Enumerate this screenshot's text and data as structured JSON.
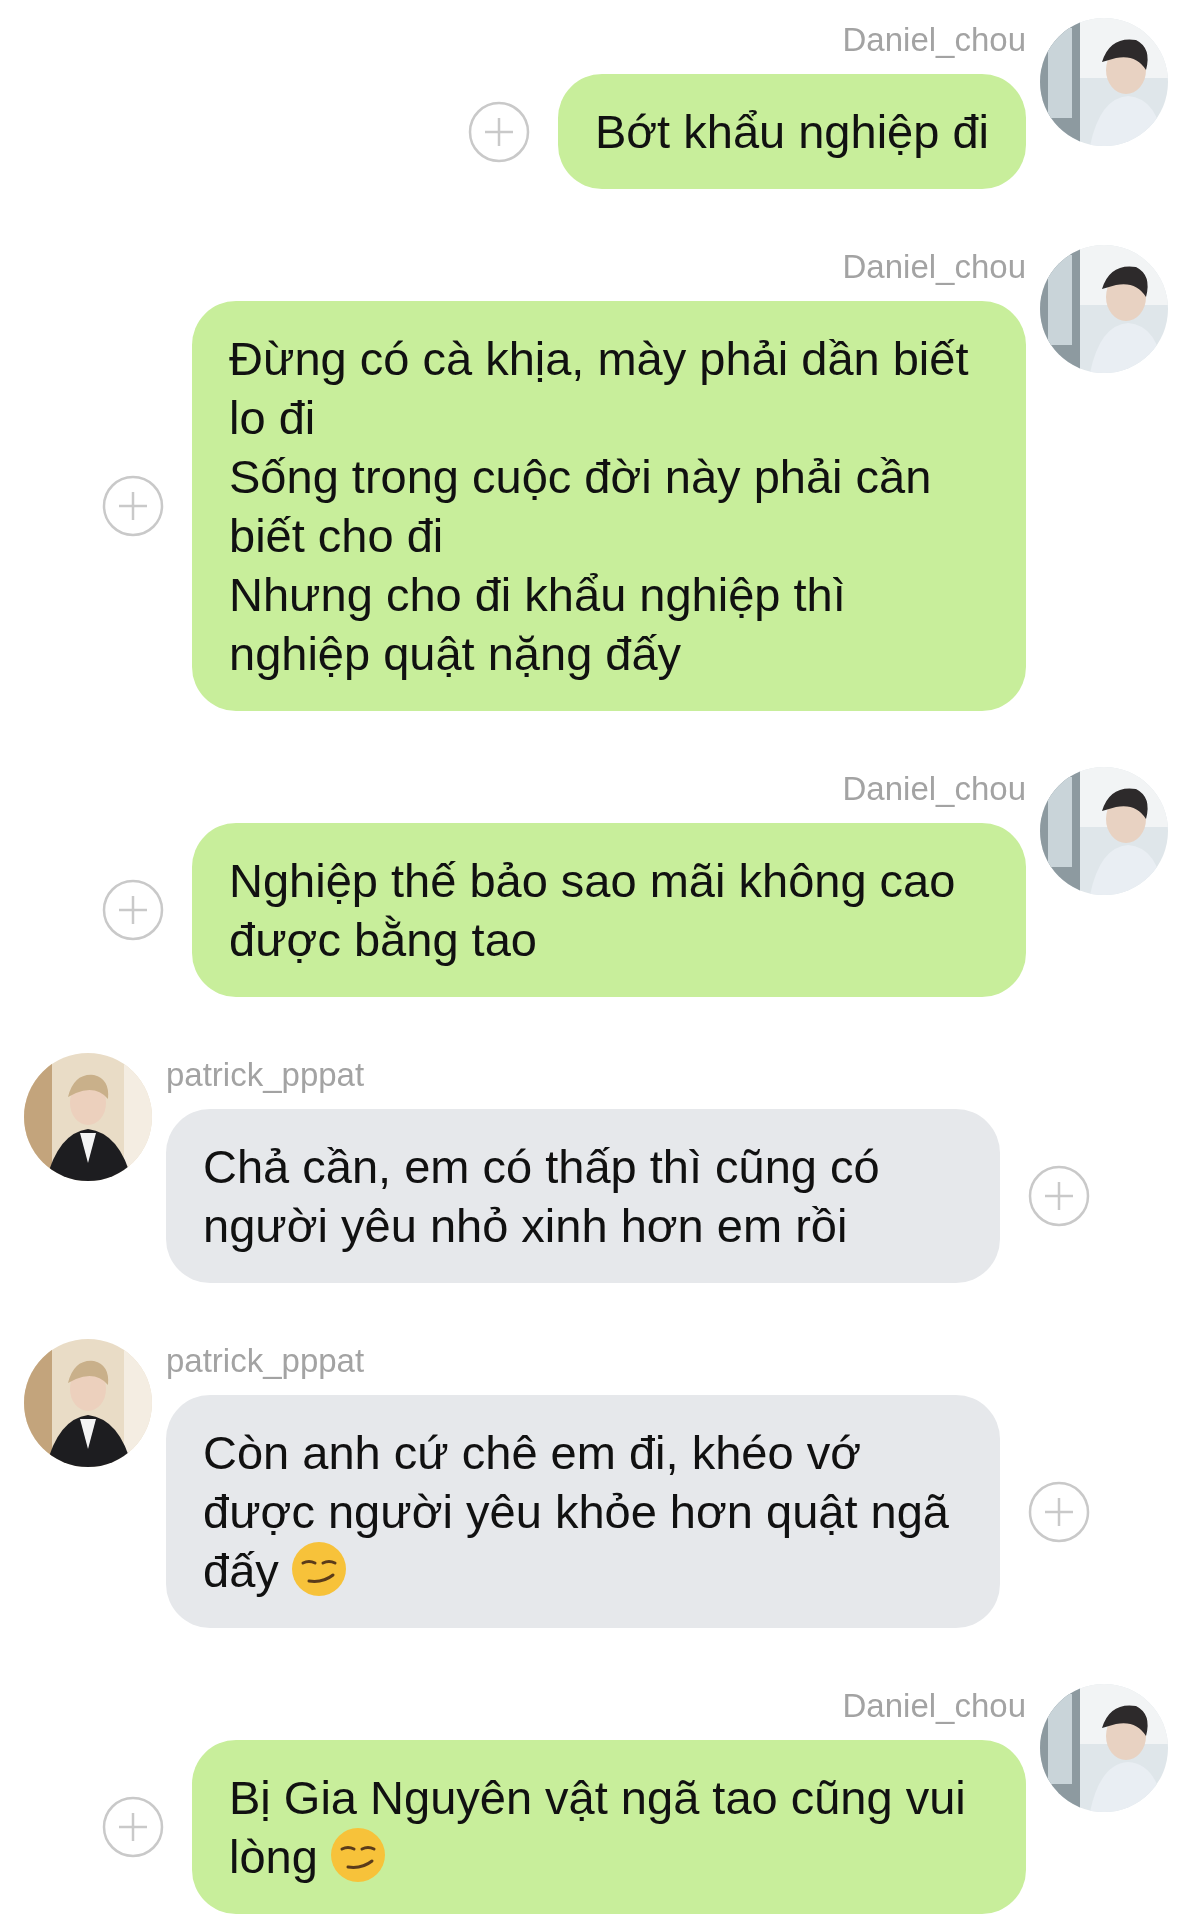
{
  "messages": [
    {
      "kind": "outgoing",
      "sender": "Daniel_chou",
      "paragraphs": [
        "Bớt khẩu nghiệp đi"
      ]
    },
    {
      "kind": "outgoing",
      "sender": "Daniel_chou",
      "paragraphs": [
        "Đừng có cà khịa, mày phải dần biết lo đi",
        "Sống trong cuộc đời này phải cần biết cho đi",
        "Nhưng cho đi khẩu nghiệp thì nghiệp quật nặng đấy"
      ]
    },
    {
      "kind": "outgoing",
      "sender": "Daniel_chou",
      "paragraphs": [
        "Nghiệp thế bảo sao mãi không cao được bằng tao"
      ]
    },
    {
      "kind": "incoming",
      "sender": "patrick_pppat",
      "paragraphs": [
        "Chả cần, em có thấp thì cũng có người yêu nhỏ xinh hơn em rồi"
      ]
    },
    {
      "kind": "incoming",
      "sender": "patrick_pppat",
      "paragraphs": [
        "Còn anh cứ chê em đi, khéo vớ được người yêu khỏe hơn quật ngã đấy"
      ],
      "emoji": {
        "kind": "smirk"
      }
    },
    {
      "kind": "outgoing",
      "sender": "Daniel_chou",
      "paragraphs": [
        "Bị Gia Nguyên vật ngã tao cũng vui lòng"
      ],
      "emoji": {
        "kind": "smirk"
      }
    }
  ]
}
